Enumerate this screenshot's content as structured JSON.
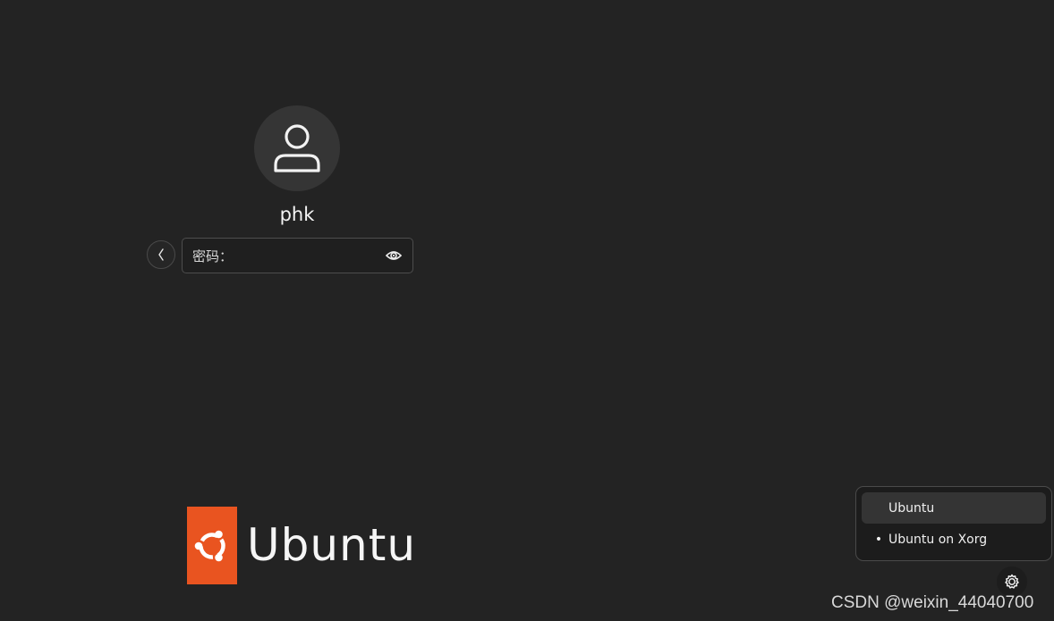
{
  "user": {
    "name": "phk",
    "avatar_icon": "user-avatar-icon"
  },
  "login": {
    "back_icon": "chevron-left-icon",
    "password_label": "密码：",
    "password_value": "",
    "reveal_icon": "eye-icon"
  },
  "branding": {
    "wordmark": "Ubuntu",
    "logo_color": "#e95420"
  },
  "session_menu": {
    "items": [
      {
        "label": "Ubuntu",
        "selected": false,
        "highlighted": true
      },
      {
        "label": "Ubuntu on Xorg",
        "selected": true,
        "highlighted": false
      }
    ],
    "selected_marker": "•"
  },
  "settings": {
    "icon": "gear-icon"
  },
  "watermark": {
    "text": "CSDN @weixin_44040700"
  },
  "colors": {
    "background": "#232323",
    "accent": "#e95420"
  }
}
